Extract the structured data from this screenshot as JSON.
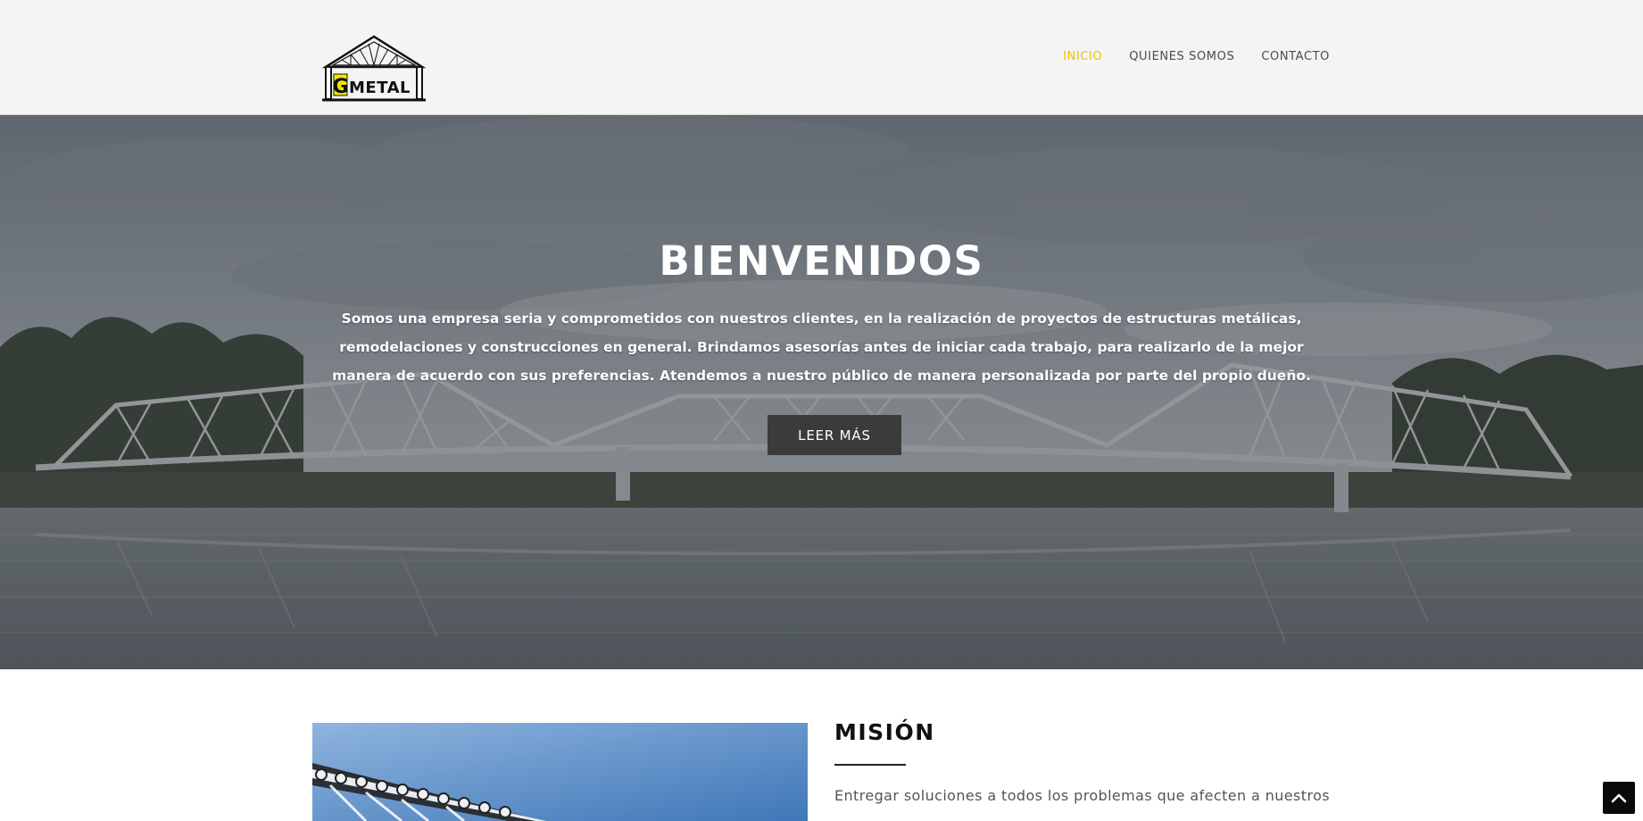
{
  "header": {
    "logo": {
      "text": "GMETAL",
      "accent_color": "#f2e600"
    },
    "nav": [
      {
        "label": "INICIO",
        "active": true
      },
      {
        "label": "QUIENES SOMOS",
        "active": false
      },
      {
        "label": "CONTACTO",
        "active": false
      }
    ],
    "active_color": "#f2c200"
  },
  "hero": {
    "title": "BIENVENIDOS",
    "description": "Somos una empresa seria y comprometidos con nuestros clientes, en la realización de proyectos de estructuras metálicas, remodelaciones y construcciones en general. Brindamos asesorías antes de iniciar cada trabajo, para realizarlo de la mejor manera de acuerdo con sus preferencias. Atendemos a nuestro público de manera personalizada por parte del propio dueño.",
    "button_label": "LEER MÁS"
  },
  "mision": {
    "title": "MISIÓN",
    "text": "Entregar soluciones a todos los problemas que afecten a nuestros"
  },
  "back_to_top": {
    "icon": "chevron-up-icon"
  }
}
